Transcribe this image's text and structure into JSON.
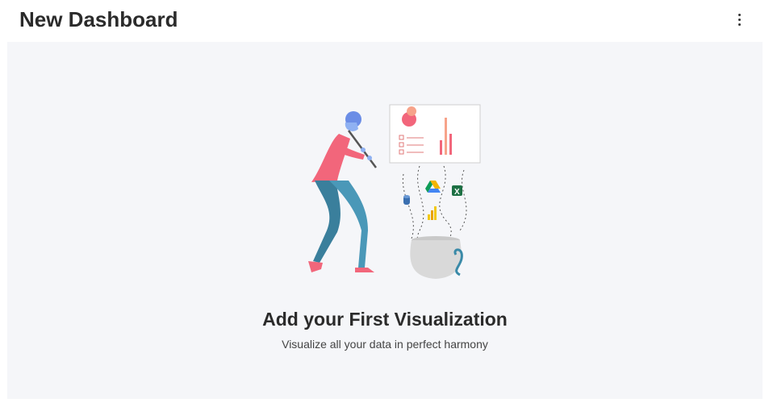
{
  "header": {
    "title": "New Dashboard",
    "menu_icon": "more-vertical-icon"
  },
  "empty_state": {
    "title": "Add your First Visualization",
    "subtitle": "Visualize all your data in perfect harmony",
    "illustration": "person-playing-flute-data-sources-illustration"
  },
  "colors": {
    "background": "#ffffff",
    "canvas": "#f5f6f9",
    "title_text": "#2b2b2b",
    "shirt": "#f2667b",
    "pants": "#3a8aa8",
    "skin": "#6b8de6",
    "pot": "#d9d9d9"
  }
}
